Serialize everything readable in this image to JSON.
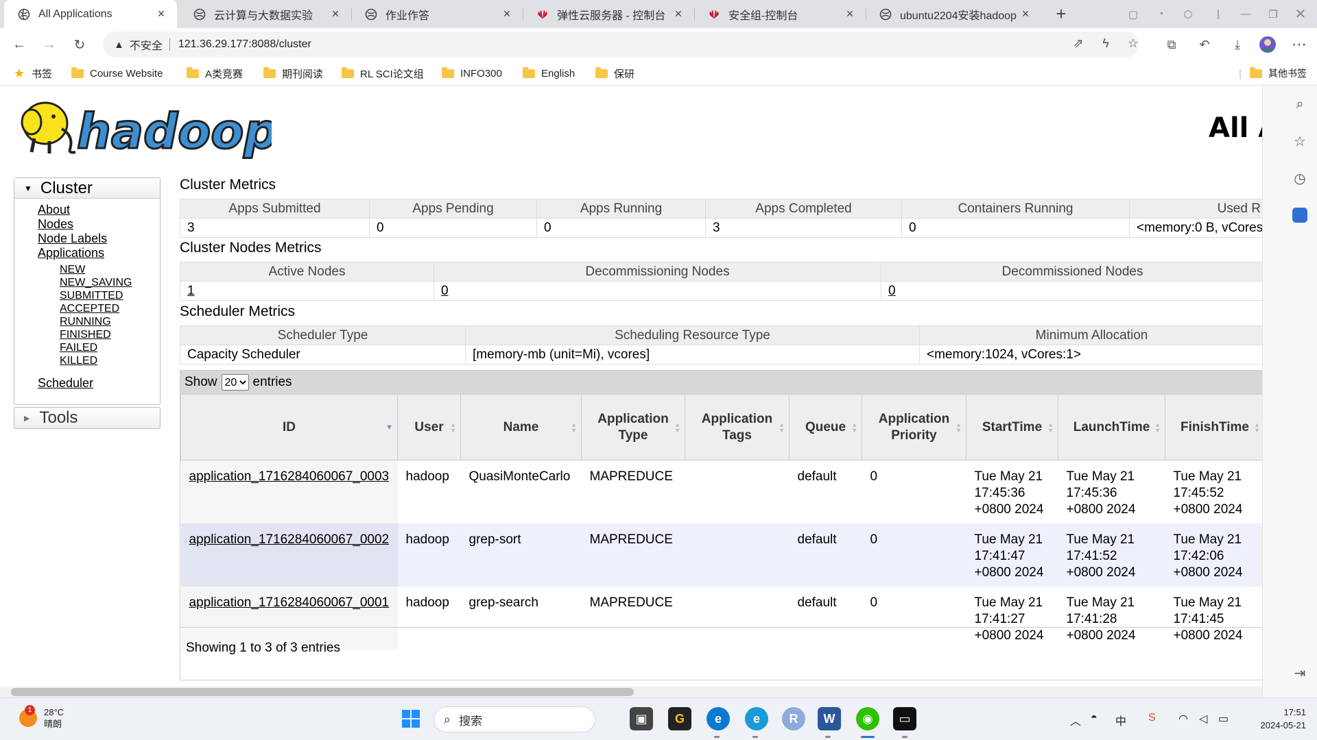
{
  "browser": {
    "tabs": [
      {
        "title": "All Applications",
        "active": true,
        "icon": "globe-icon"
      },
      {
        "title": "云计算与大数据实验",
        "active": false,
        "icon": "globe-icon"
      },
      {
        "title": "作业作答",
        "active": false,
        "icon": "globe-icon"
      },
      {
        "title": "弹性云服务器 - 控制台",
        "active": false,
        "icon": "huawei-icon"
      },
      {
        "title": "安全组-控制台",
        "active": false,
        "icon": "huawei-icon"
      },
      {
        "title": "ubuntu2204安装hadoop",
        "active": false,
        "icon": "globe-icon"
      }
    ],
    "address": {
      "insecure_label": "不安全",
      "url": "121.36.29.177:8088/cluster"
    },
    "bookmarks": [
      {
        "label": "书签",
        "type": "star"
      },
      {
        "label": "Course Website",
        "type": "folder"
      },
      {
        "label": "A类竞赛",
        "type": "folder"
      },
      {
        "label": "期刊阅读",
        "type": "folder"
      },
      {
        "label": "RL SCI论文组",
        "type": "folder"
      },
      {
        "label": "INFO300",
        "type": "folder"
      },
      {
        "label": "English",
        "type": "folder"
      },
      {
        "label": "保研",
        "type": "folder"
      }
    ],
    "other_bookmarks": "其他书签"
  },
  "page": {
    "heading": "All A",
    "sidebar": {
      "cluster_title": "Cluster",
      "links": [
        "About",
        "Nodes",
        "Node Labels",
        "Applications"
      ],
      "app_states": [
        "NEW",
        "NEW_SAVING",
        "SUBMITTED",
        "ACCEPTED",
        "RUNNING",
        "FINISHED",
        "FAILED",
        "KILLED"
      ],
      "scheduler": "Scheduler",
      "tools_title": "Tools"
    },
    "cluster_metrics": {
      "title": "Cluster Metrics",
      "headers": [
        "Apps Submitted",
        "Apps Pending",
        "Apps Running",
        "Apps Completed",
        "Containers Running",
        "Used R"
      ],
      "values": [
        "3",
        "0",
        "0",
        "3",
        "0",
        "<memory:0 B, vCores"
      ]
    },
    "nodes_metrics": {
      "title": "Cluster Nodes Metrics",
      "headers": [
        "Active Nodes",
        "Decommissioning Nodes",
        "Decommissioned Nodes"
      ],
      "values": [
        "1",
        "0",
        "0"
      ]
    },
    "scheduler_metrics": {
      "title": "Scheduler Metrics",
      "headers": [
        "Scheduler Type",
        "Scheduling Resource Type",
        "Minimum Allocation"
      ],
      "values": [
        "Capacity Scheduler",
        "[memory-mb (unit=Mi), vcores]",
        "<memory:1024, vCores:1>"
      ]
    },
    "apps": {
      "show_label": "Show",
      "page_size": "20",
      "entries_label": "entries",
      "columns": [
        "ID",
        "User",
        "Name",
        "Application Type",
        "Application Tags",
        "Queue",
        "Application Priority",
        "StartTime",
        "LaunchTime",
        "FinishTime"
      ],
      "rows": [
        {
          "id": "application_1716284060067_0003",
          "user": "hadoop",
          "name": "QuasiMonteCarlo",
          "type": "MAPREDUCE",
          "tags": "",
          "queue": "default",
          "priority": "0",
          "start": [
            "Tue May 21",
            "17:45:36",
            "+0800 2024"
          ],
          "launch": [
            "Tue May 21",
            "17:45:36",
            "+0800 2024"
          ],
          "finish": [
            "Tue May 21",
            "17:45:52",
            "+0800 2024"
          ]
        },
        {
          "id": "application_1716284060067_0002",
          "user": "hadoop",
          "name": "grep-sort",
          "type": "MAPREDUCE",
          "tags": "",
          "queue": "default",
          "priority": "0",
          "start": [
            "Tue May 21",
            "17:41:47",
            "+0800 2024"
          ],
          "launch": [
            "Tue May 21",
            "17:41:52",
            "+0800 2024"
          ],
          "finish": [
            "Tue May 21",
            "17:42:06",
            "+0800 2024"
          ]
        },
        {
          "id": "application_1716284060067_0001",
          "user": "hadoop",
          "name": "grep-search",
          "type": "MAPREDUCE",
          "tags": "",
          "queue": "default",
          "priority": "0",
          "start": [
            "Tue May 21",
            "17:41:27",
            "+0800 2024"
          ],
          "launch": [
            "Tue May 21",
            "17:41:28",
            "+0800 2024"
          ],
          "finish": [
            "Tue May 21",
            "17:41:45",
            "+0800 2024"
          ]
        }
      ],
      "footer": "Showing 1 to 3 of 3 entries"
    }
  },
  "taskbar": {
    "weather_temp": "28°C",
    "weather_desc": "晴朗",
    "weather_badge": "1",
    "search_placeholder": "搜索",
    "ime": "中",
    "time": "17:51",
    "date": "2024-05-21"
  },
  "colors": {
    "hadoop_blue": "#3d8fd1",
    "hadoop_yellow": "#f9e21b",
    "row_alt": "#eef0fb"
  }
}
